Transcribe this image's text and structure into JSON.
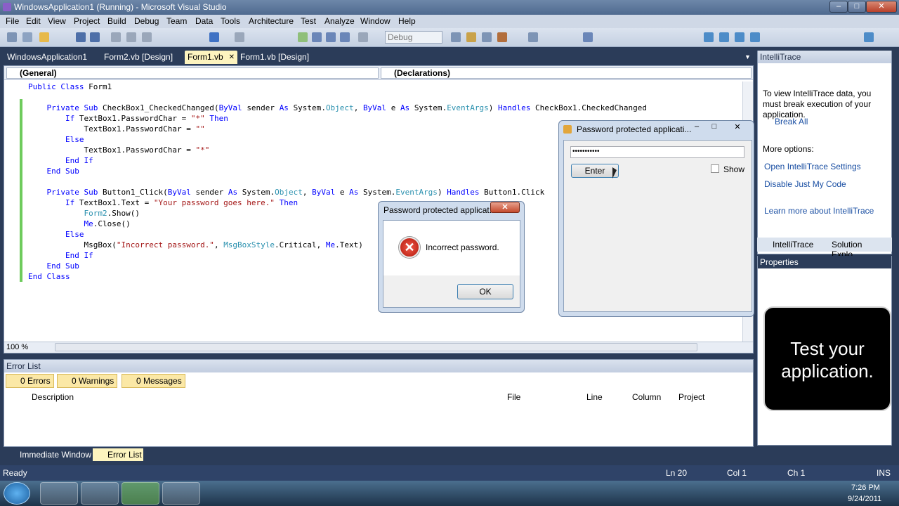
{
  "window": {
    "title": "WindowsApplication1 (Running) - Microsoft Visual Studio",
    "min": "–",
    "max": "□",
    "close": "✕"
  },
  "menu": [
    "File",
    "Edit",
    "View",
    "Project",
    "Build",
    "Debug",
    "Team",
    "Data",
    "Tools",
    "Architecture",
    "Test",
    "Analyze",
    "Window",
    "Help"
  ],
  "toolbar": {
    "config": "Debug"
  },
  "tabs": [
    {
      "label": "WindowsApplication1"
    },
    {
      "label": "Form2.vb [Design]"
    },
    {
      "label": "Form1.vb",
      "close": "✕"
    },
    {
      "label": "Form1.vb [Design]"
    }
  ],
  "editor": {
    "left_combo": "(General)",
    "right_combo": "(Declarations)",
    "zoom": "100 %",
    "lines": [
      "Public Class Form1",
      "",
      "    Private Sub CheckBox1_CheckedChanged(ByVal sender As System.Object, ByVal e As System.EventArgs) Handles CheckBox1.CheckedChanged",
      "        If TextBox1.PasswordChar = \"*\" Then",
      "            TextBox1.PasswordChar = \"\"",
      "        Else",
      "            TextBox1.PasswordChar = \"*\"",
      "        End If",
      "    End Sub",
      "",
      "    Private Sub Button1_Click(ByVal sender As System.Object, ByVal e As System.EventArgs) Handles Button1.Click",
      "        If TextBox1.Text = \"Your password goes here.\" Then",
      "            Form2.Show()",
      "            Me.Close()",
      "        Else",
      "            MsgBox(\"Incorrect password.\", MsgBoxStyle.Critical, Me.Text)",
      "        End If",
      "    End Sub",
      "End Class"
    ]
  },
  "intellitrace": {
    "title": "IntelliTrace",
    "message": "To view IntelliTrace data, you must break execution of your application.",
    "break_all": "Break All",
    "more_options": "More options:",
    "links": [
      "Open IntelliTrace Settings",
      "Disable Just My Code",
      "Learn more about IntelliTrace"
    ],
    "tab1": "IntelliTrace",
    "tab2": "Solution Explo..."
  },
  "properties": {
    "title": "Properties"
  },
  "error_list": {
    "title": "Error List",
    "errors": "0 Errors",
    "warnings": "0 Warnings",
    "messages": "0 Messages",
    "columns": [
      "Description",
      "File",
      "Line",
      "Column",
      "Project"
    ]
  },
  "bottom_tabs": [
    "Immediate Window",
    "Error List"
  ],
  "status": {
    "ready": "Ready",
    "ln": "Ln 20",
    "col": "Col 1",
    "ch": "Ch 1",
    "ins": "INS"
  },
  "taskbar": {
    "time": "7:26 PM",
    "date": "9/24/2011"
  },
  "password_form": {
    "title": "Password protected applicati...",
    "field_value": "•••••••••••",
    "enter": "Enter",
    "show": "Show"
  },
  "message_box": {
    "title": "Password protected applicat...",
    "close": "✕",
    "text": "Incorrect password.",
    "ok": "OK",
    "icon": "error-icon"
  },
  "callout": {
    "text": "Test your application."
  },
  "colors": {
    "keyword": "#0000ff",
    "type": "#2b91af",
    "string": "#a31515",
    "chrome": "#2b3c59",
    "active_tab": "#fdf4bf"
  }
}
